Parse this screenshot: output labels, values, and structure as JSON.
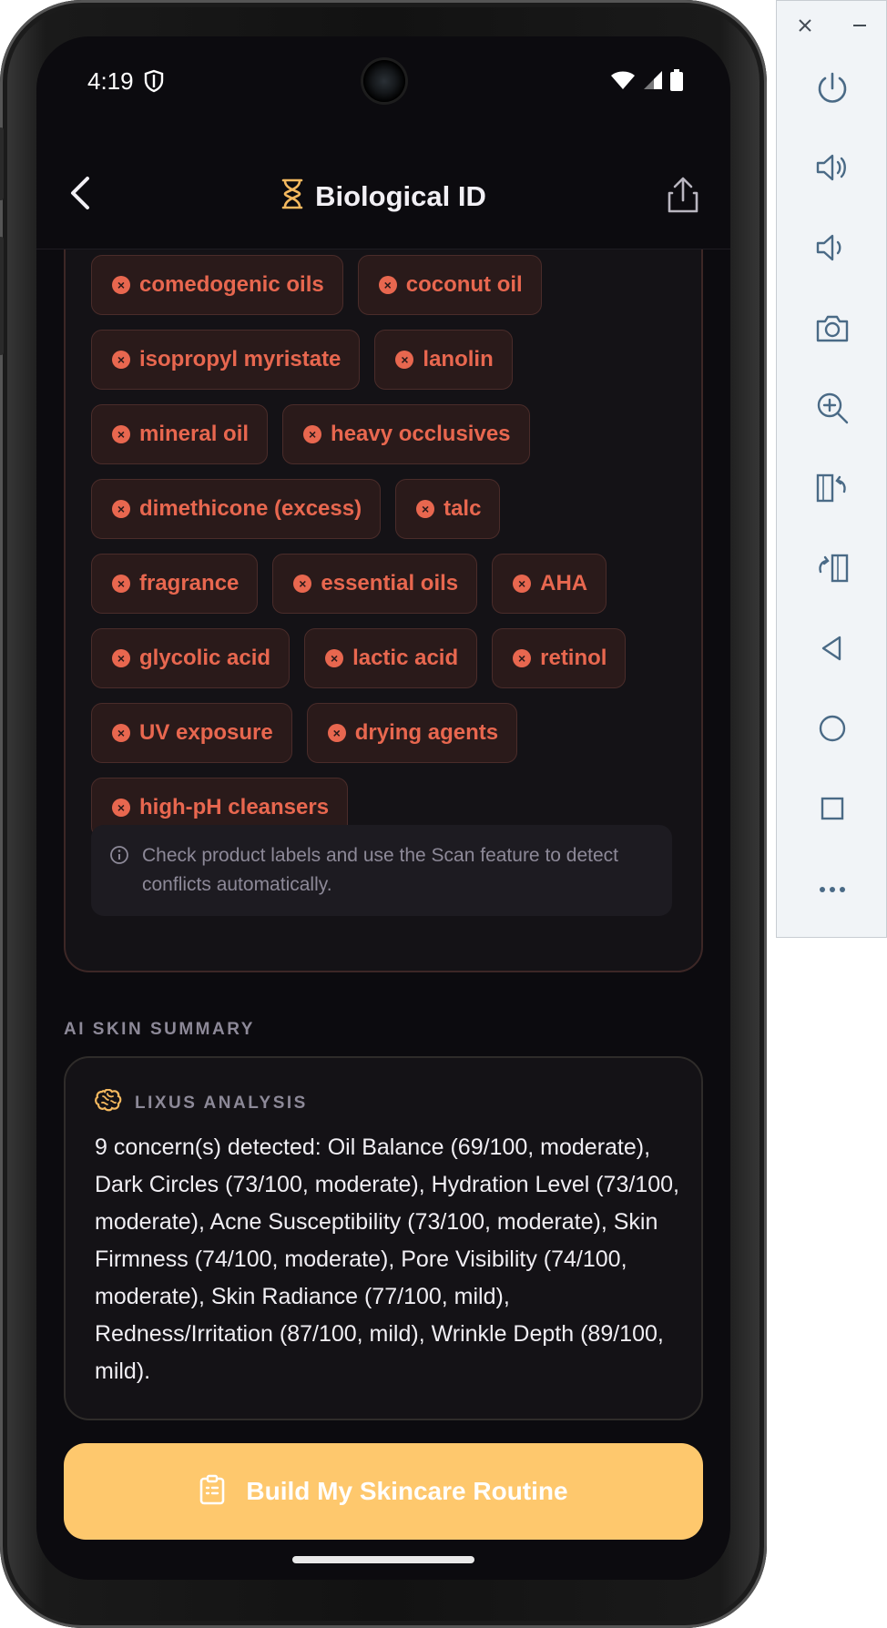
{
  "status_bar": {
    "time": "4:19"
  },
  "header": {
    "title": "Biological ID"
  },
  "avoid_chips": [
    [
      "comedogenic oils",
      "coconut oil"
    ],
    [
      "isopropyl myristate",
      "lanolin"
    ],
    [
      "mineral oil",
      "heavy occlusives"
    ],
    [
      "dimethicone (excess)",
      "talc"
    ],
    [
      "fragrance",
      "essential oils",
      "AHA"
    ],
    [
      "glycolic acid",
      "lactic acid",
      "retinol"
    ],
    [
      "UV exposure",
      "drying agents"
    ],
    [
      "high-pH cleansers"
    ]
  ],
  "note": {
    "text": "Check product labels and use the Scan feature to detect conflicts automatically."
  },
  "summary_section": {
    "label": "AI SKIN SUMMARY"
  },
  "summary_card": {
    "label": "LIXUS ANALYSIS",
    "text": "9 concern(s) detected: Oil Balance (69/100, moderate), Dark Circles (73/100, moderate), Hydration Level (73/100, moderate), Acne Susceptibility (73/100, moderate), Skin Firmness (74/100, moderate), Pore Visibility (74/100, moderate), Skin Radiance (77/100, mild), Redness/Irritation (87/100, mild), Wrinkle Depth (89/100, mild)."
  },
  "cta": {
    "label": "Build My Skincare Routine"
  },
  "colors": {
    "background": "#0c0b0f",
    "chip_text": "#e8674f",
    "chip_bg": "#2a1a1a",
    "accent": "#fec86d",
    "muted": "#8d8998"
  },
  "icons": {
    "header": [
      "back-chevron-icon",
      "dna-icon",
      "share-icon"
    ],
    "emulator_panel": [
      "close-icon",
      "minimize-icon",
      "power-icon",
      "volume-up-icon",
      "volume-down-icon",
      "camera-icon",
      "zoom-icon",
      "rotate-left-icon",
      "rotate-right-icon",
      "back-icon",
      "home-icon",
      "overview-icon",
      "more-icon"
    ]
  }
}
